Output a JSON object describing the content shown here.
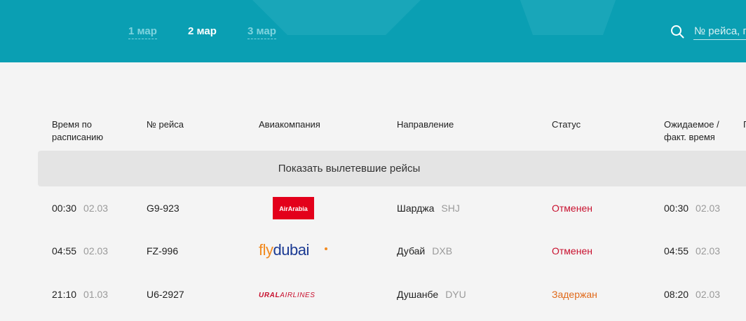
{
  "header": {
    "date_tabs": [
      {
        "label": "1 мар"
      },
      {
        "label": "2 мар"
      },
      {
        "label": "3 мар"
      }
    ],
    "active_tab_index": 1,
    "search": {
      "placeholder": "№ рейса, город"
    }
  },
  "table": {
    "columns": {
      "scheduled": "Время по расписанию",
      "flight": "№ рейса",
      "airline": "Авиакомпания",
      "destination": "Направление",
      "status": "Статус",
      "actual": "Ожидаемое / факт. время",
      "extra": "Г"
    },
    "show_departed": "Показать вылетевшие рейсы",
    "rows": [
      {
        "time": "00:30",
        "date": "02.03",
        "flight": "G9-923",
        "airline_logo": "AirArabia",
        "city": "Шарджа",
        "code": "SHJ",
        "status": "Отменен",
        "status_color": "#c8102e",
        "actual_time": "00:30",
        "actual_date": "02.03"
      },
      {
        "time": "04:55",
        "date": "02.03",
        "flight": "FZ-996",
        "airline_logo": "flydubai",
        "city": "Дубай",
        "code": "DXB",
        "status": "Отменен",
        "status_color": "#c8102e",
        "actual_time": "04:55",
        "actual_date": "02.03"
      },
      {
        "time": "21:10",
        "date": "01.03",
        "flight": "U6-2927",
        "airline_logo": "URAL AIRLINES",
        "city": "Душанбе",
        "code": "DYU",
        "status": "Задержан",
        "status_color": "#e06a1b",
        "actual_time": "08:20",
        "actual_date": "02.03"
      }
    ]
  },
  "colors": {
    "header_bg": "#0a9fb3",
    "cancel": "#c8102e",
    "delay": "#e06a1b",
    "page_bg": "#f4f4f4"
  }
}
